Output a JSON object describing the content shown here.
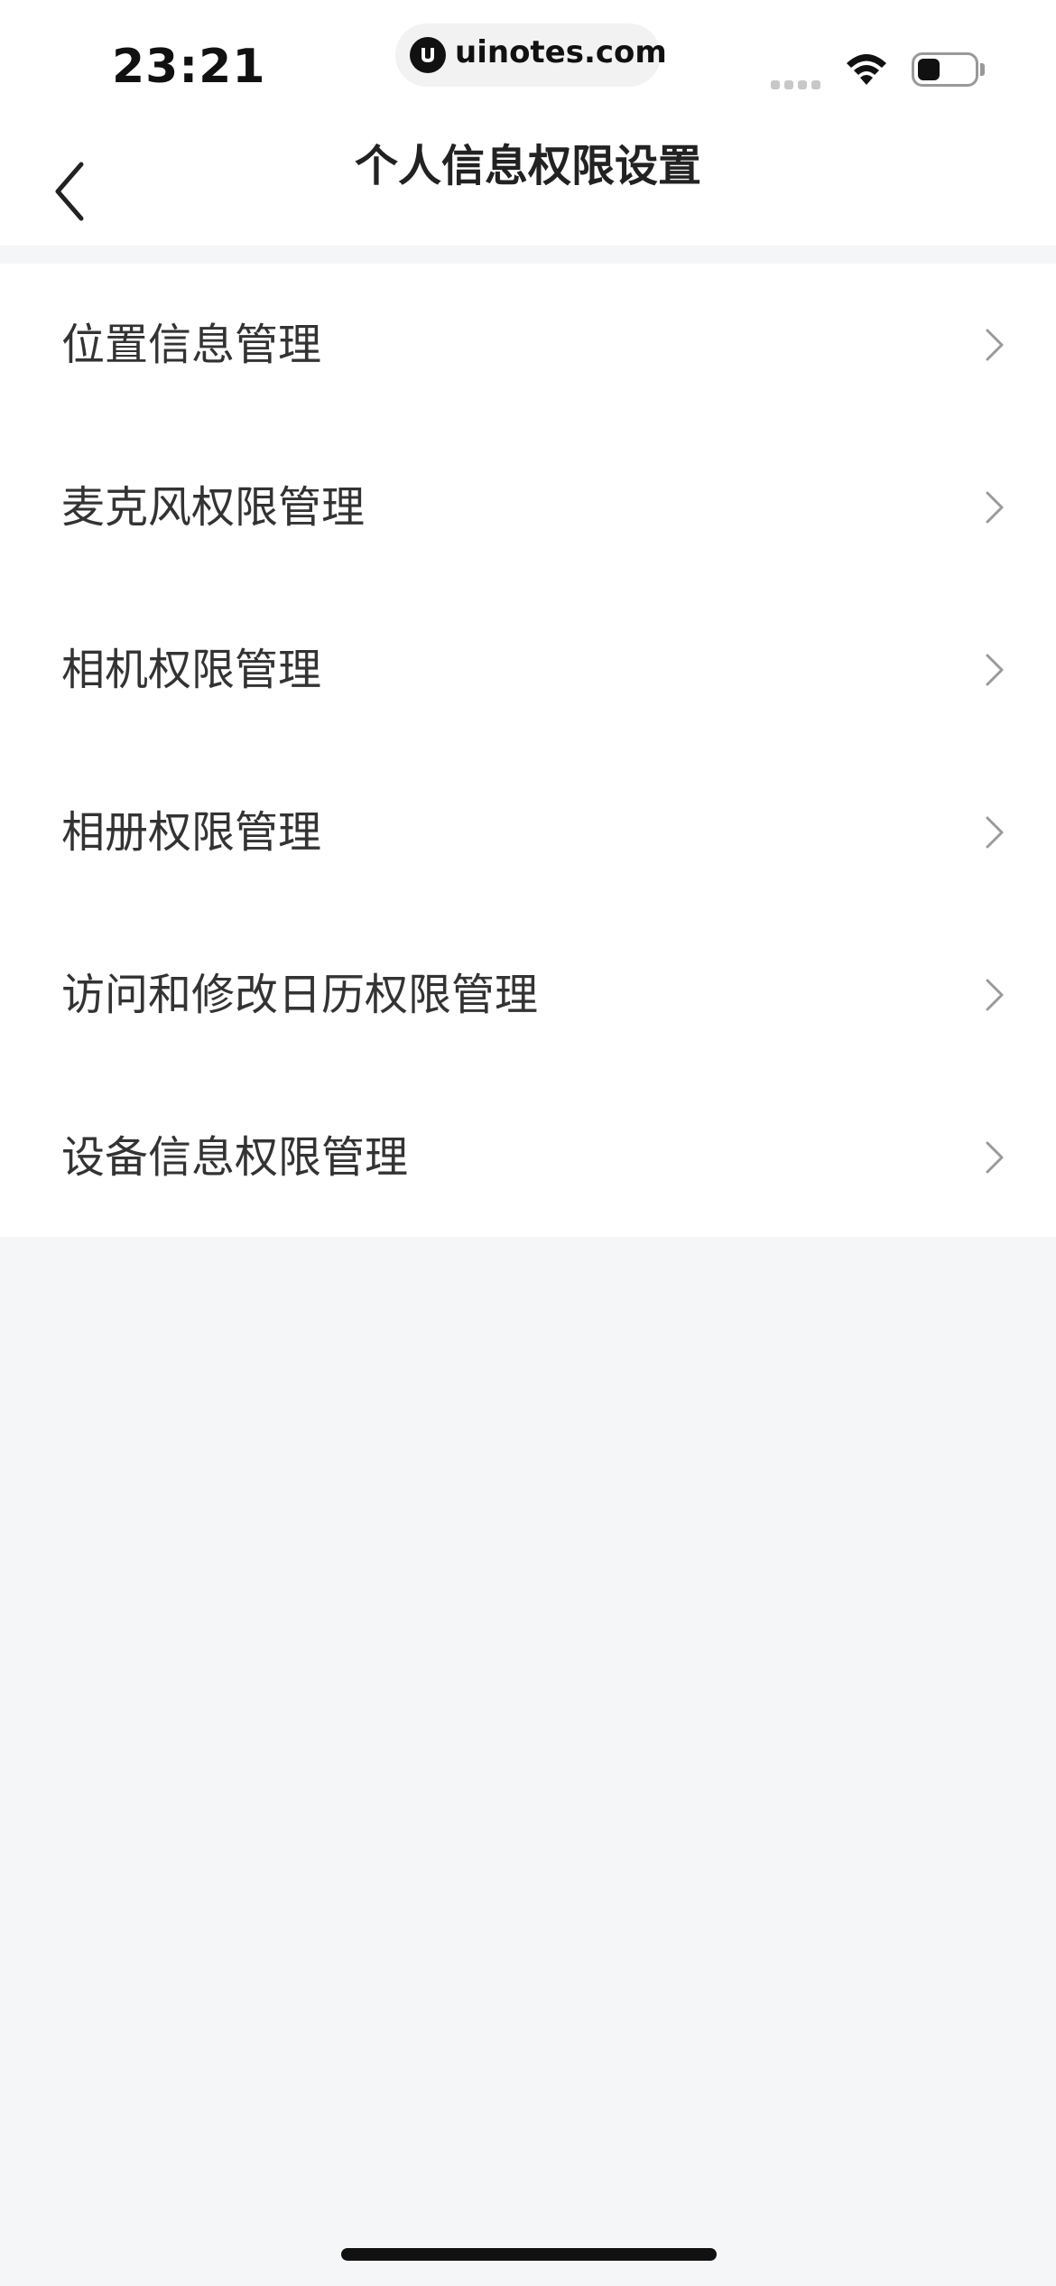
{
  "status_bar": {
    "time": "23:21",
    "url": "uinotes.com",
    "battery_level": 0.4
  },
  "header": {
    "title": "个人信息权限设置"
  },
  "menu": {
    "items": [
      {
        "label": "位置信息管理"
      },
      {
        "label": "麦克风权限管理"
      },
      {
        "label": "相机权限管理"
      },
      {
        "label": "相册权限管理"
      },
      {
        "label": "访问和修改日历权限管理"
      },
      {
        "label": "设备信息权限管理"
      }
    ]
  },
  "colors": {
    "page_background": "#f5f6f8",
    "surface": "#ffffff",
    "text_primary": "#333333",
    "chevron": "#9a9a9a"
  },
  "icons": {
    "back": "chevron-left-icon",
    "row_arrow": "chevron-right-icon",
    "wifi": "wifi-icon",
    "battery": "battery-icon",
    "signal": "cellular-signal-icon"
  }
}
